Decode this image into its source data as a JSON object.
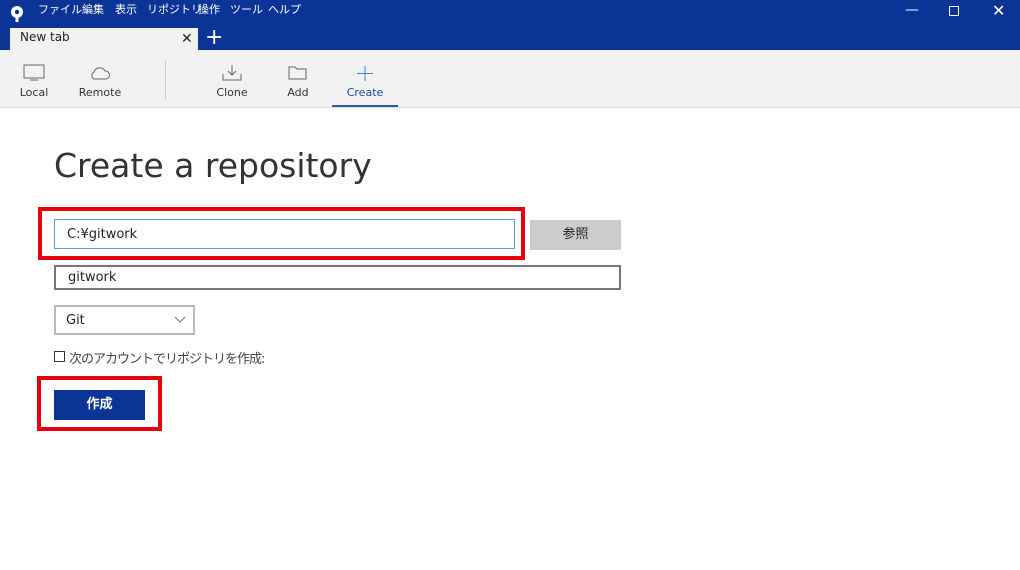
{
  "menu": [
    "ファイル",
    "編集",
    "表示",
    "リポジトリ",
    "操作",
    "ツール",
    "ヘルプ"
  ],
  "tab": {
    "label": "New tab"
  },
  "toolbar": {
    "local": "Local",
    "remote": "Remote",
    "clone": "Clone",
    "add": "Add",
    "create": "Create"
  },
  "page": {
    "title": "Create a repository",
    "path_value": "C:¥gitwork",
    "browse_label": "参照",
    "name_value": "gitwork",
    "type_selected": "Git",
    "checkbox_label": "次のアカウントでリポジトリを作成:",
    "create_label": "作成"
  },
  "colors": {
    "brand": "#0a3596",
    "highlight": "#e8000d"
  }
}
